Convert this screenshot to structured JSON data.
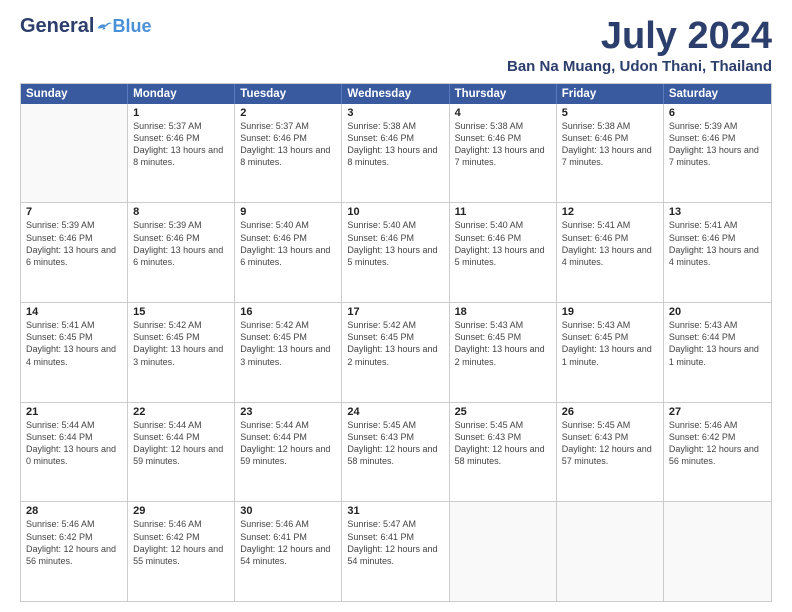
{
  "header": {
    "logo_general": "General",
    "logo_blue": "Blue",
    "month_year": "July 2024",
    "location": "Ban Na Muang, Udon Thani, Thailand"
  },
  "calendar": {
    "days_of_week": [
      "Sunday",
      "Monday",
      "Tuesday",
      "Wednesday",
      "Thursday",
      "Friday",
      "Saturday"
    ],
    "rows": [
      [
        {
          "day": "",
          "sunrise": "",
          "sunset": "",
          "daylight": ""
        },
        {
          "day": "1",
          "sunrise": "Sunrise: 5:37 AM",
          "sunset": "Sunset: 6:46 PM",
          "daylight": "Daylight: 13 hours and 8 minutes."
        },
        {
          "day": "2",
          "sunrise": "Sunrise: 5:37 AM",
          "sunset": "Sunset: 6:46 PM",
          "daylight": "Daylight: 13 hours and 8 minutes."
        },
        {
          "day": "3",
          "sunrise": "Sunrise: 5:38 AM",
          "sunset": "Sunset: 6:46 PM",
          "daylight": "Daylight: 13 hours and 8 minutes."
        },
        {
          "day": "4",
          "sunrise": "Sunrise: 5:38 AM",
          "sunset": "Sunset: 6:46 PM",
          "daylight": "Daylight: 13 hours and 7 minutes."
        },
        {
          "day": "5",
          "sunrise": "Sunrise: 5:38 AM",
          "sunset": "Sunset: 6:46 PM",
          "daylight": "Daylight: 13 hours and 7 minutes."
        },
        {
          "day": "6",
          "sunrise": "Sunrise: 5:39 AM",
          "sunset": "Sunset: 6:46 PM",
          "daylight": "Daylight: 13 hours and 7 minutes."
        }
      ],
      [
        {
          "day": "7",
          "sunrise": "Sunrise: 5:39 AM",
          "sunset": "Sunset: 6:46 PM",
          "daylight": "Daylight: 13 hours and 6 minutes."
        },
        {
          "day": "8",
          "sunrise": "Sunrise: 5:39 AM",
          "sunset": "Sunset: 6:46 PM",
          "daylight": "Daylight: 13 hours and 6 minutes."
        },
        {
          "day": "9",
          "sunrise": "Sunrise: 5:40 AM",
          "sunset": "Sunset: 6:46 PM",
          "daylight": "Daylight: 13 hours and 6 minutes."
        },
        {
          "day": "10",
          "sunrise": "Sunrise: 5:40 AM",
          "sunset": "Sunset: 6:46 PM",
          "daylight": "Daylight: 13 hours and 5 minutes."
        },
        {
          "day": "11",
          "sunrise": "Sunrise: 5:40 AM",
          "sunset": "Sunset: 6:46 PM",
          "daylight": "Daylight: 13 hours and 5 minutes."
        },
        {
          "day": "12",
          "sunrise": "Sunrise: 5:41 AM",
          "sunset": "Sunset: 6:46 PM",
          "daylight": "Daylight: 13 hours and 4 minutes."
        },
        {
          "day": "13",
          "sunrise": "Sunrise: 5:41 AM",
          "sunset": "Sunset: 6:46 PM",
          "daylight": "Daylight: 13 hours and 4 minutes."
        }
      ],
      [
        {
          "day": "14",
          "sunrise": "Sunrise: 5:41 AM",
          "sunset": "Sunset: 6:45 PM",
          "daylight": "Daylight: 13 hours and 4 minutes."
        },
        {
          "day": "15",
          "sunrise": "Sunrise: 5:42 AM",
          "sunset": "Sunset: 6:45 PM",
          "daylight": "Daylight: 13 hours and 3 minutes."
        },
        {
          "day": "16",
          "sunrise": "Sunrise: 5:42 AM",
          "sunset": "Sunset: 6:45 PM",
          "daylight": "Daylight: 13 hours and 3 minutes."
        },
        {
          "day": "17",
          "sunrise": "Sunrise: 5:42 AM",
          "sunset": "Sunset: 6:45 PM",
          "daylight": "Daylight: 13 hours and 2 minutes."
        },
        {
          "day": "18",
          "sunrise": "Sunrise: 5:43 AM",
          "sunset": "Sunset: 6:45 PM",
          "daylight": "Daylight: 13 hours and 2 minutes."
        },
        {
          "day": "19",
          "sunrise": "Sunrise: 5:43 AM",
          "sunset": "Sunset: 6:45 PM",
          "daylight": "Daylight: 13 hours and 1 minute."
        },
        {
          "day": "20",
          "sunrise": "Sunrise: 5:43 AM",
          "sunset": "Sunset: 6:44 PM",
          "daylight": "Daylight: 13 hours and 1 minute."
        }
      ],
      [
        {
          "day": "21",
          "sunrise": "Sunrise: 5:44 AM",
          "sunset": "Sunset: 6:44 PM",
          "daylight": "Daylight: 13 hours and 0 minutes."
        },
        {
          "day": "22",
          "sunrise": "Sunrise: 5:44 AM",
          "sunset": "Sunset: 6:44 PM",
          "daylight": "Daylight: 12 hours and 59 minutes."
        },
        {
          "day": "23",
          "sunrise": "Sunrise: 5:44 AM",
          "sunset": "Sunset: 6:44 PM",
          "daylight": "Daylight: 12 hours and 59 minutes."
        },
        {
          "day": "24",
          "sunrise": "Sunrise: 5:45 AM",
          "sunset": "Sunset: 6:43 PM",
          "daylight": "Daylight: 12 hours and 58 minutes."
        },
        {
          "day": "25",
          "sunrise": "Sunrise: 5:45 AM",
          "sunset": "Sunset: 6:43 PM",
          "daylight": "Daylight: 12 hours and 58 minutes."
        },
        {
          "day": "26",
          "sunrise": "Sunrise: 5:45 AM",
          "sunset": "Sunset: 6:43 PM",
          "daylight": "Daylight: 12 hours and 57 minutes."
        },
        {
          "day": "27",
          "sunrise": "Sunrise: 5:46 AM",
          "sunset": "Sunset: 6:42 PM",
          "daylight": "Daylight: 12 hours and 56 minutes."
        }
      ],
      [
        {
          "day": "28",
          "sunrise": "Sunrise: 5:46 AM",
          "sunset": "Sunset: 6:42 PM",
          "daylight": "Daylight: 12 hours and 56 minutes."
        },
        {
          "day": "29",
          "sunrise": "Sunrise: 5:46 AM",
          "sunset": "Sunset: 6:42 PM",
          "daylight": "Daylight: 12 hours and 55 minutes."
        },
        {
          "day": "30",
          "sunrise": "Sunrise: 5:46 AM",
          "sunset": "Sunset: 6:41 PM",
          "daylight": "Daylight: 12 hours and 54 minutes."
        },
        {
          "day": "31",
          "sunrise": "Sunrise: 5:47 AM",
          "sunset": "Sunset: 6:41 PM",
          "daylight": "Daylight: 12 hours and 54 minutes."
        },
        {
          "day": "",
          "sunrise": "",
          "sunset": "",
          "daylight": ""
        },
        {
          "day": "",
          "sunrise": "",
          "sunset": "",
          "daylight": ""
        },
        {
          "day": "",
          "sunrise": "",
          "sunset": "",
          "daylight": ""
        }
      ]
    ]
  }
}
